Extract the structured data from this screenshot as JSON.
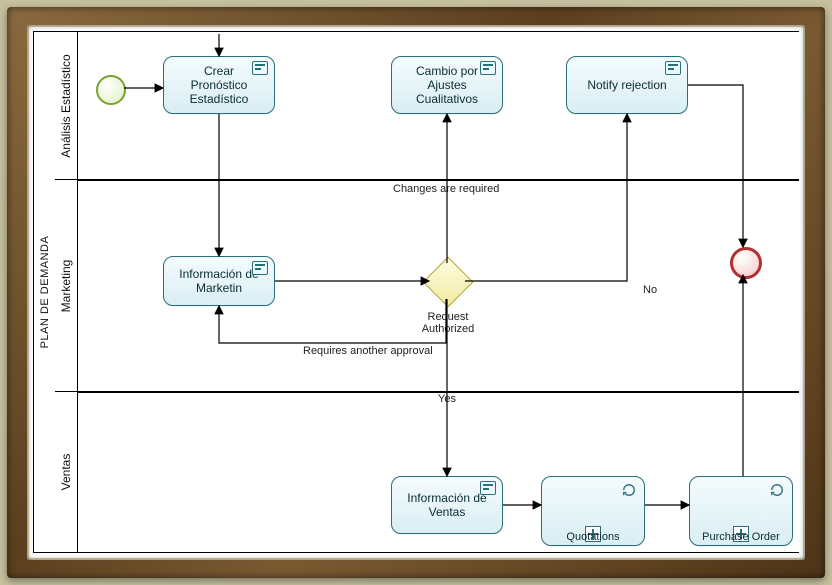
{
  "pool": {
    "title": "PLAN DE DEMANDA"
  },
  "lanes": {
    "l1": "Análisis Estadístico",
    "l2": "Marketing",
    "l3": "Ventas"
  },
  "tasks": {
    "crear": "Crear\nPronóstico\nEstadístico",
    "cambio": "Cambio por\nAjustes\nCualitativos",
    "notify": "Notify rejection",
    "infoMkt": "Información de\nMarketin",
    "infoVta": "Información de\nVentas",
    "quotations": "Quotations",
    "po": "Purchase Order"
  },
  "gateway": {
    "label": "Request\nAuthorized"
  },
  "edges": {
    "changes": "Changes are required",
    "no": "No",
    "yes": "Yes",
    "requires": "Requires another approval"
  }
}
